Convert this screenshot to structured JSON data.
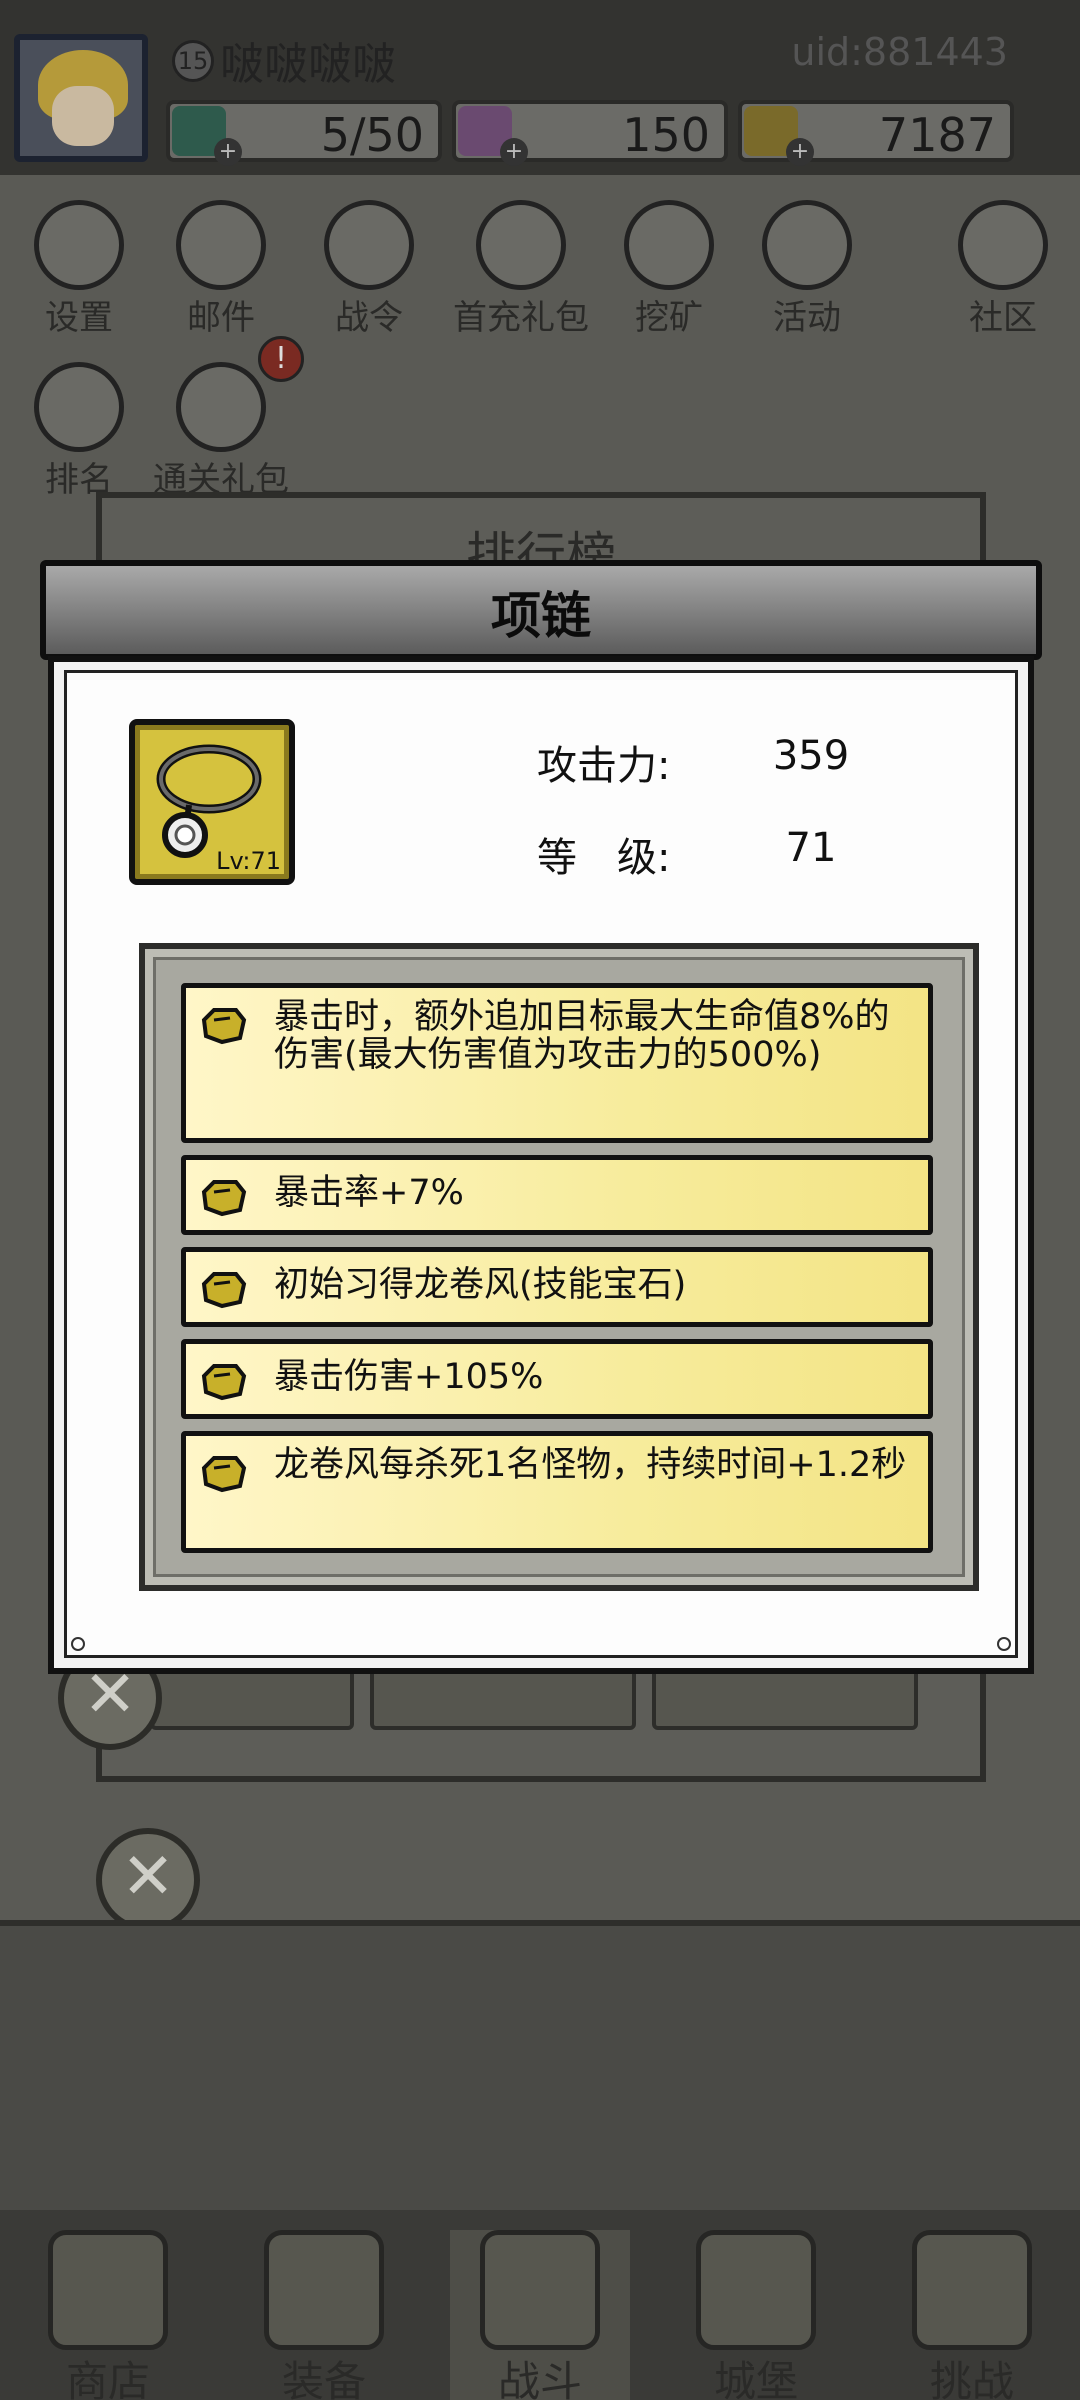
{
  "header": {
    "level": "15",
    "player_name": "啵啵啵啵",
    "uid": "uid:881443",
    "resources": [
      {
        "name": "energy",
        "value": "5/50",
        "color": "#2e7a64"
      },
      {
        "name": "gem",
        "value": "150",
        "color": "#9a5aa8"
      },
      {
        "name": "gold",
        "value": "7187",
        "color": "#c99a18"
      }
    ]
  },
  "menu": {
    "items": [
      "设置",
      "邮件",
      "战令",
      "首充礼包",
      "挖矿",
      "活动",
      "社区"
    ],
    "row2": [
      "排名",
      "通关礼包"
    ],
    "alert": "!"
  },
  "rank_panel": {
    "title": "排行榜"
  },
  "bottom_nav": {
    "items": [
      "商店",
      "装备",
      "战斗",
      "城堡",
      "挑战"
    ],
    "active": "战斗"
  },
  "dialog": {
    "title": "项链",
    "item": {
      "level_label": "Lv:71",
      "icon": "necklace-icon"
    },
    "stats": [
      {
        "label": "攻击力:",
        "value": "359"
      },
      {
        "label": "等　级:",
        "value": "71"
      }
    ],
    "attributes": [
      "暴击时，额外追加目标最大生命值8%的伤害(最大伤害值为攻击力的500%)",
      "暴击率+7%",
      "初始习得龙卷风(技能宝石)",
      "暴击伤害+105%",
      "龙卷风每杀死1名怪物，持续时间+1.2秒"
    ]
  }
}
